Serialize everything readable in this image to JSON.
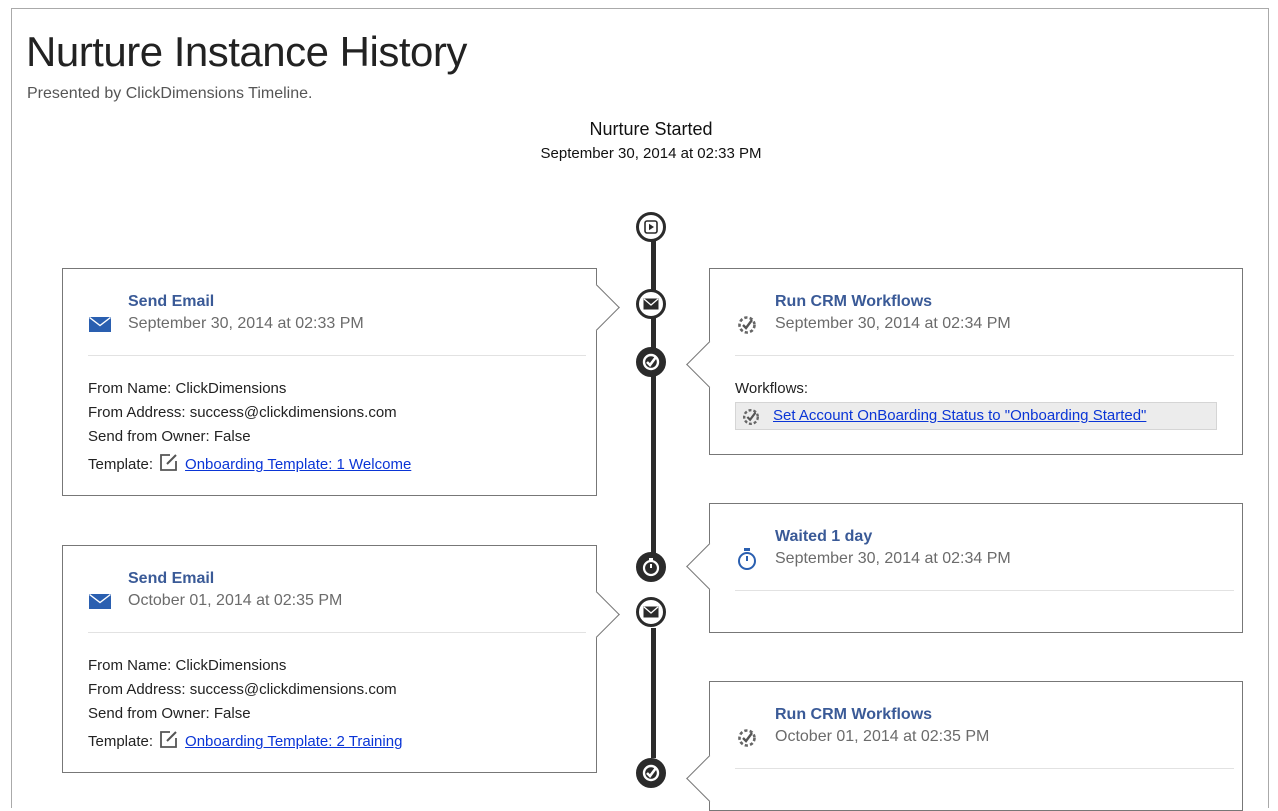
{
  "page": {
    "title": "Nurture Instance History",
    "subtitle": "Presented by ClickDimensions Timeline."
  },
  "start": {
    "title": "Nurture Started",
    "date": "September 30, 2014 at 02:33 PM"
  },
  "labels": {
    "from_name": "From Name:",
    "from_address": "From Address:",
    "send_from_owner": "Send from Owner:",
    "template": "Template:",
    "workflows": "Workflows:"
  },
  "events": [
    {
      "title": "Send Email",
      "date": "September 30, 2014 at 02:33 PM",
      "from_name": "ClickDimensions",
      "from_address": "success@clickdimensions.com",
      "send_from_owner": "False",
      "template": "Onboarding Template: 1 Welcome"
    },
    {
      "title": "Run CRM Workflows",
      "date": "September 30, 2014 at 02:34 PM",
      "workflow": "Set Account OnBoarding Status to \"Onboarding Started\""
    },
    {
      "title": "Waited 1 day",
      "date": "September 30, 2014 at 02:34 PM"
    },
    {
      "title": "Send Email",
      "date": "October 01, 2014 at 02:35 PM",
      "from_name": "ClickDimensions",
      "from_address": "success@clickdimensions.com",
      "send_from_owner": "False",
      "template": "Onboarding Template: 2 Training"
    },
    {
      "title": "Run CRM Workflows",
      "date": "October 01, 2014 at 02:35 PM"
    }
  ],
  "icons": {
    "start": "play-icon",
    "email": "envelope-icon",
    "workflow": "workflow-gear-icon",
    "wait": "stopwatch-icon",
    "template": "edit-template-icon",
    "accent": "#3a5a97",
    "link": "#0a35d6"
  }
}
